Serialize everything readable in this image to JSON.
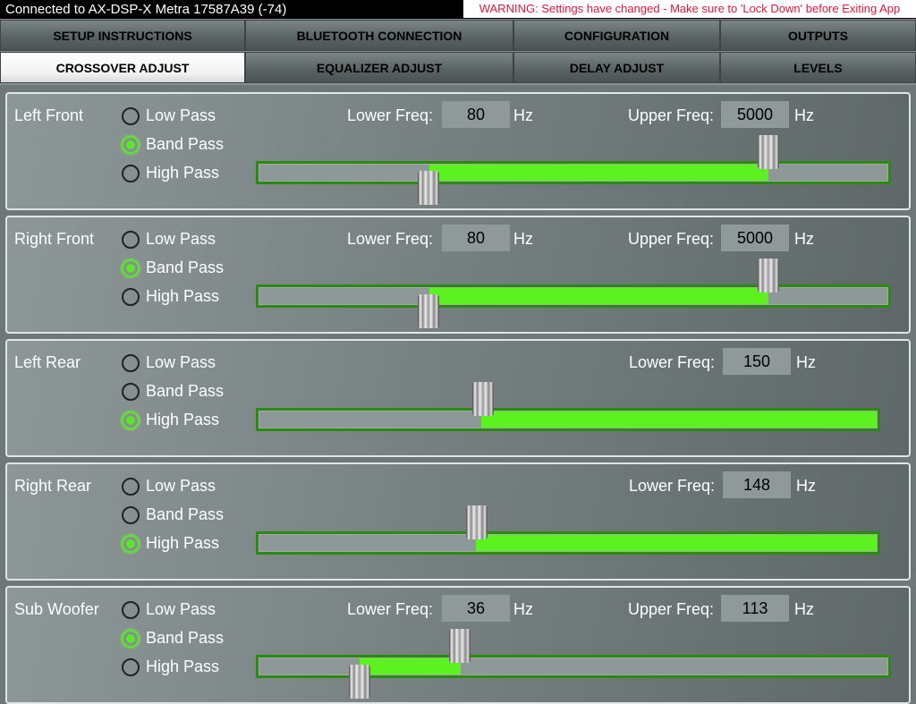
{
  "status": {
    "connection": "Connected to AX-DSP-X Metra 17587A39 (-74)",
    "warning": "WARNING: Settings have changed - Make sure to 'Lock Down' before Exiting App"
  },
  "tabs": [
    {
      "label": "SETUP INSTRUCTIONS",
      "active": false
    },
    {
      "label": "BLUETOOTH CONNECTION",
      "active": false
    },
    {
      "label": "CONFIGURATION",
      "active": false
    },
    {
      "label": "OUTPUTS",
      "active": false
    },
    {
      "label": "CROSSOVER ADJUST",
      "active": true
    },
    {
      "label": "EQUALIZER ADJUST",
      "active": false
    },
    {
      "label": "DELAY ADJUST",
      "active": false
    },
    {
      "label": "LEVELS",
      "active": false
    }
  ],
  "filter_options": [
    "Low Pass",
    "Band Pass",
    "High Pass"
  ],
  "lower_label": "Lower Freq:",
  "upper_label": "Upper Freq:",
  "unit": "Hz",
  "colors": {
    "accent": "#5cf21f",
    "track_border": "#2d8a10",
    "warning": "#e3173e"
  },
  "channels": [
    {
      "name": "Left Front",
      "mode": "Band Pass",
      "lower": "80",
      "upper": "5000",
      "lower_pct": 27,
      "upper_pct": 81
    },
    {
      "name": "Right Front",
      "mode": "Band Pass",
      "lower": "80",
      "upper": "5000",
      "lower_pct": 27,
      "upper_pct": 81
    },
    {
      "name": "Left Rear",
      "mode": "High Pass",
      "lower": "150",
      "lower_pct": 36
    },
    {
      "name": "Right Rear",
      "mode": "High Pass",
      "lower": "148",
      "lower_pct": 35
    },
    {
      "name": "Sub Woofer",
      "mode": "Band Pass",
      "lower": "36",
      "upper": "113",
      "lower_pct": 16,
      "upper_pct": 32
    }
  ]
}
